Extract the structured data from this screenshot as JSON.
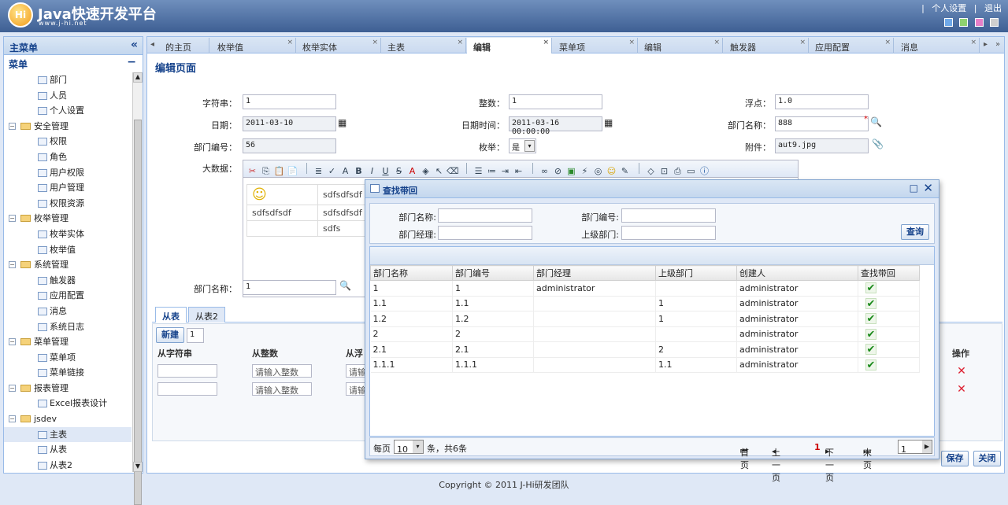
{
  "header": {
    "logo_text": "Hi",
    "title": "Java快速开发平台",
    "subtitle": "www.j-hi.net",
    "links": [
      "个人设置",
      "退出"
    ],
    "link_separator": "|",
    "swatch_colors": [
      "#6fa8e8",
      "#8fd16f",
      "#e77fc8",
      "#cfcfcf"
    ]
  },
  "sidebar": {
    "title": "主菜单",
    "collapse_icon": "«",
    "root_label": "菜单",
    "root_collapse_icon": "−",
    "items": [
      {
        "type": "leaf",
        "label": "部门"
      },
      {
        "type": "leaf",
        "label": "人员"
      },
      {
        "type": "leaf",
        "label": "个人设置"
      },
      {
        "type": "group",
        "label": "安全管理"
      },
      {
        "type": "leaf",
        "label": "权限"
      },
      {
        "type": "leaf",
        "label": "角色"
      },
      {
        "type": "leaf",
        "label": "用户权限"
      },
      {
        "type": "leaf",
        "label": "用户管理"
      },
      {
        "type": "leaf",
        "label": "权限资源"
      },
      {
        "type": "group",
        "label": "枚举管理"
      },
      {
        "type": "leaf",
        "label": "枚举实体"
      },
      {
        "type": "leaf",
        "label": "枚举值"
      },
      {
        "type": "group",
        "label": "系统管理"
      },
      {
        "type": "leaf",
        "label": "触发器"
      },
      {
        "type": "leaf",
        "label": "应用配置"
      },
      {
        "type": "leaf",
        "label": "消息"
      },
      {
        "type": "leaf",
        "label": "系统日志"
      },
      {
        "type": "group",
        "label": "菜单管理"
      },
      {
        "type": "leaf",
        "label": "菜单项"
      },
      {
        "type": "leaf",
        "label": "菜单链接"
      },
      {
        "type": "group",
        "label": "报表管理"
      },
      {
        "type": "leaf",
        "label": "Excel报表设计"
      },
      {
        "type": "group",
        "label": "jsdev"
      },
      {
        "type": "leaf",
        "label": "主表",
        "selected": true
      },
      {
        "type": "leaf",
        "label": "从表"
      },
      {
        "type": "leaf",
        "label": "从表2"
      }
    ]
  },
  "tabs": {
    "prev_icon": "◂",
    "next_icon": "▸",
    "expand_icon": "»",
    "close_glyph": "×",
    "items": [
      {
        "label": "的主页"
      },
      {
        "label": "枚举值"
      },
      {
        "label": "枚举实体"
      },
      {
        "label": "主表"
      },
      {
        "label": "编辑",
        "active": true
      },
      {
        "label": "菜单项"
      },
      {
        "label": "编辑"
      },
      {
        "label": "触发器"
      },
      {
        "label": "应用配置"
      },
      {
        "label": "消息"
      }
    ]
  },
  "form": {
    "page_title": "编辑页面",
    "fields": {
      "string_label": "字符串：",
      "string_value": "1",
      "int_label": "整数：",
      "int_value": "1",
      "float_label": "浮点：",
      "float_value": "1.0",
      "date_label": "日期：",
      "date_value": "2011-03-10",
      "datetime_label": "日期时间：",
      "datetime_value": "2011-03-16 00:00:00",
      "dept_name_label": "部门名称：",
      "dept_name_value": "888",
      "dept_no_label": "部门编号：",
      "dept_no_value": "56",
      "enum_label": "枚举：",
      "enum_value": "是",
      "attachment_label": "附件：",
      "attachment_value": "aut9.jpg",
      "bigdata_label": "大数据：",
      "dept_name2_label": "部门名称：",
      "dept_name2_value": "1",
      "required_mark": "*"
    },
    "rte_cells": [
      "sdfsdfsdf",
      "sdfsdfsdf",
      "sdfsdfsdf",
      "sdfs"
    ]
  },
  "detail": {
    "tabs": [
      "从表",
      "从表2"
    ],
    "new_label": "新建",
    "count_value": "1",
    "columns": {
      "c1": "从字符串",
      "c2": "从整数",
      "c3": "从浮",
      "action": "操作"
    },
    "int_placeholder": "请输入整数",
    "float_placeholder_clip": "请输",
    "delete_glyph": "✕"
  },
  "buttons": {
    "save": "保存",
    "close": "关闭"
  },
  "footer": "Copyright © 2011 J-Hi研发团队",
  "dialog": {
    "title": "查找带回",
    "maximize_glyph": "□",
    "close_glyph": "✕",
    "q_dept_name": "部门名称:",
    "q_dept_no": "部门编号:",
    "q_dept_mgr": "部门经理:",
    "q_parent": "上级部门:",
    "search_button": "查询",
    "columns": [
      "部门名称",
      "部门编号",
      "部门经理",
      "上级部门",
      "创建人",
      "查找带回"
    ],
    "check_glyph": "✔",
    "rows": [
      [
        "1",
        "1",
        "administrator",
        "",
        "administrator"
      ],
      [
        "1.1",
        "1.1",
        "",
        "1",
        "administrator"
      ],
      [
        "1.2",
        "1.2",
        "",
        "1",
        "administrator"
      ],
      [
        "2",
        "2",
        "",
        "",
        "administrator"
      ],
      [
        "2.1",
        "2.1",
        "",
        "2",
        "administrator"
      ],
      [
        "1.1.1",
        "1.1.1",
        "",
        "1.1",
        "administrator"
      ]
    ],
    "pager": {
      "per_page": "每页",
      "page_size": "10",
      "dropdown_glyph": "▾",
      "summary": "条，共6条",
      "first": "首页",
      "prev": "上一页",
      "current": "1",
      "next": "下一页",
      "last": "末页",
      "page_input": "1",
      "go_glyph": "▶"
    }
  }
}
